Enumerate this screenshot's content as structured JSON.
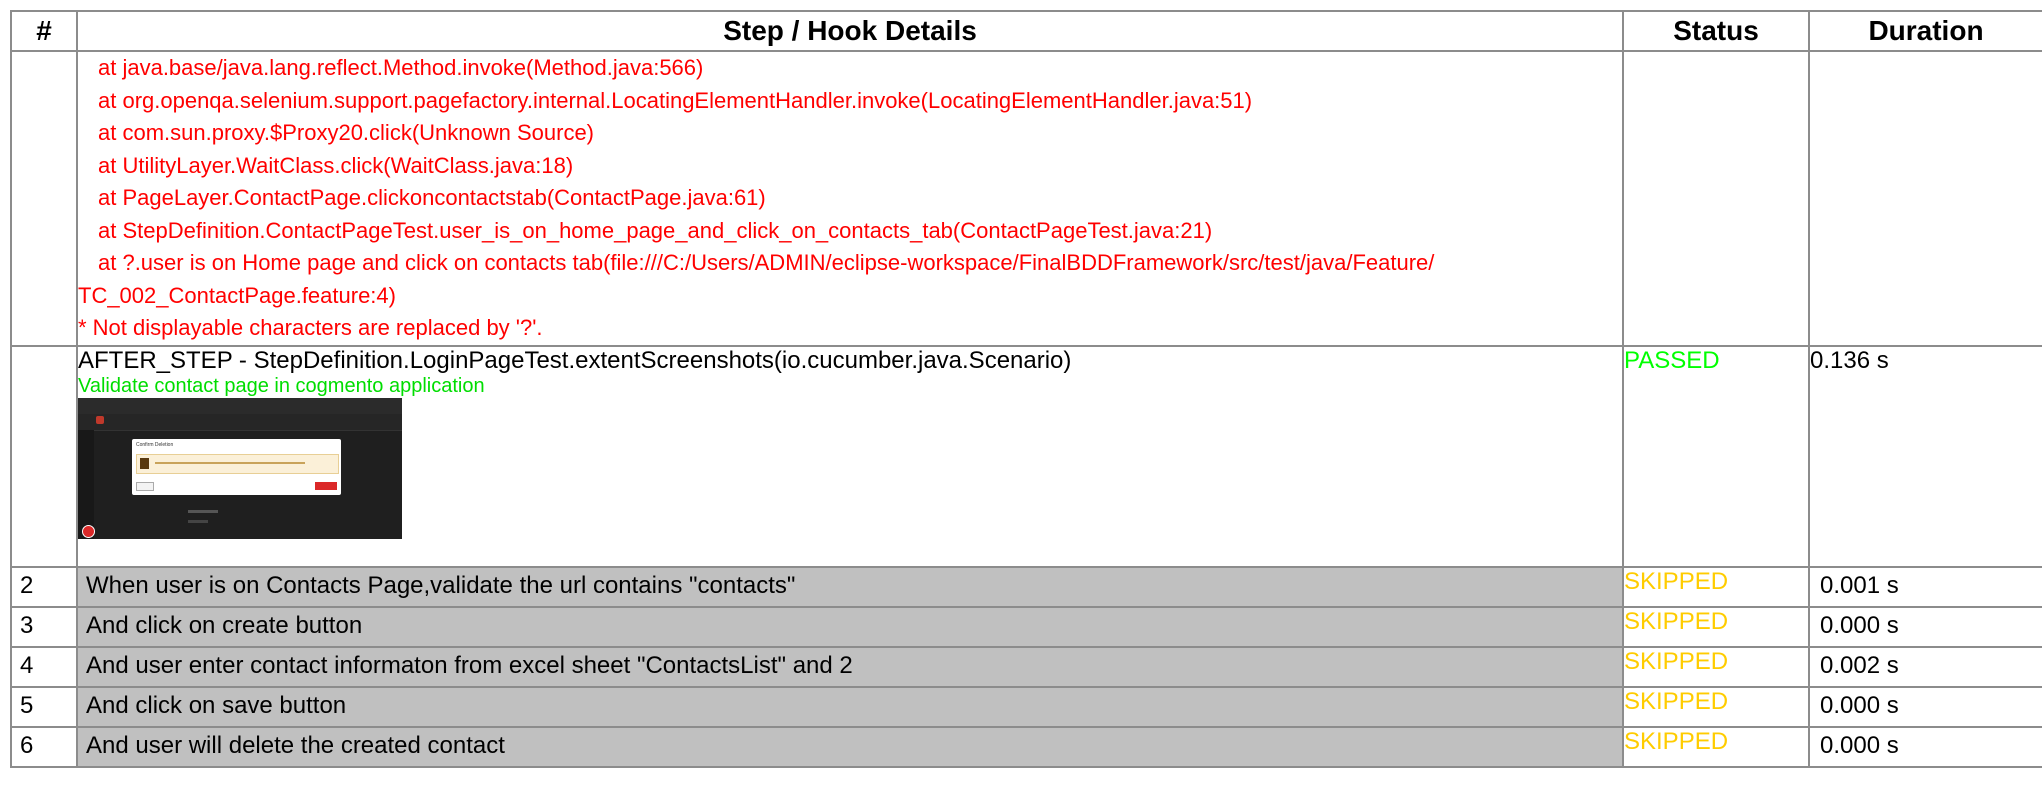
{
  "headers": {
    "num": "#",
    "details": "Step / Hook Details",
    "status": "Status",
    "duration": "Duration"
  },
  "stack_trace": [
    "at java.base/java.lang.reflect.Method.invoke(Method.java:566)",
    "at org.openqa.selenium.support.pagefactory.internal.LocatingElementHandler.invoke(LocatingElementHandler.java:51)",
    "at com.sun.proxy.$Proxy20.click(Unknown Source)",
    "at UtilityLayer.WaitClass.click(WaitClass.java:18)",
    "at PageLayer.ContactPage.clickoncontactstab(ContactPage.java:61)",
    "at StepDefinition.ContactPageTest.user_is_on_home_page_and_click_on_contacts_tab(ContactPageTest.java:21)",
    "at ?.user is on Home page and click on contacts tab(file:///C:/Users/ADMIN/eclipse-workspace/FinalBDDFramework/src/test/java/Feature/"
  ],
  "stack_continuation": "TC_002_ContactPage.feature:4)",
  "stack_note": "* Not displayable characters are replaced by '?'.",
  "hook": {
    "name": "AFTER_STEP - StepDefinition.LoginPageTest.extentScreenshots(io.cucumber.java.Scenario)",
    "description": "Validate contact page in cogmento application",
    "status": "PASSED",
    "duration": "0.136 s"
  },
  "screenshot": {
    "dialog_title": "Confirm Deletion"
  },
  "steps": [
    {
      "num": "2",
      "text": "When user is on Contacts Page,validate the url contains \"contacts\"",
      "status": "SKIPPED",
      "duration": "0.001 s"
    },
    {
      "num": "3",
      "text": "And click on create button",
      "status": "SKIPPED",
      "duration": "0.000 s"
    },
    {
      "num": "4",
      "text": "And user enter contact informaton from excel sheet \"ContactsList\" and 2",
      "status": "SKIPPED",
      "duration": "0.002 s"
    },
    {
      "num": "5",
      "text": "And click on save button",
      "status": "SKIPPED",
      "duration": "0.000 s"
    },
    {
      "num": "6",
      "text": "And user will delete the created contact",
      "status": "SKIPPED",
      "duration": "0.000 s"
    }
  ],
  "colors": {
    "error": "#ff0000",
    "passed": "#00ff00",
    "skipped": "#ffcc00",
    "description": "#00dd00",
    "skipped_row_bg": "#c0c0c0"
  }
}
